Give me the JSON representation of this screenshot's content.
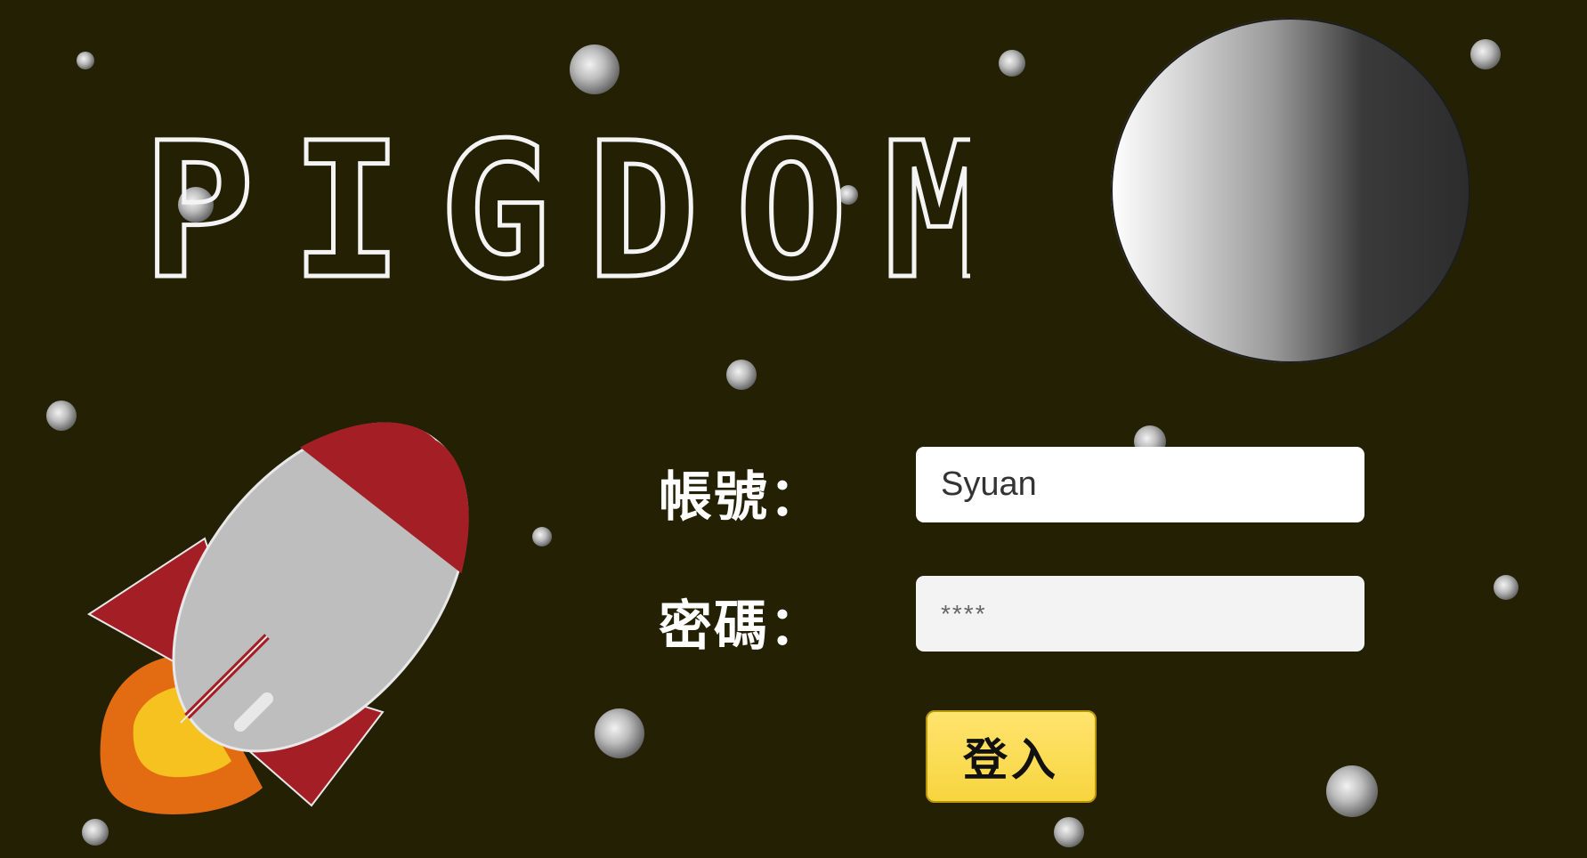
{
  "app": {
    "logo_text": "PIGDOM"
  },
  "login_form": {
    "username_label": "帳號：",
    "username_value": "Syuan",
    "password_label": "密碼：",
    "password_placeholder": "****",
    "submit_label": "登入"
  },
  "colors": {
    "background": "#232003",
    "accent_button": "#f7d53f",
    "rocket_red": "#a41f25",
    "rocket_body": "#bebebe",
    "flame_outer": "#e36c12",
    "flame_inner": "#f5c21f"
  },
  "icons": [
    "rocket-illustration",
    "planet-illustration",
    "star-dot"
  ]
}
